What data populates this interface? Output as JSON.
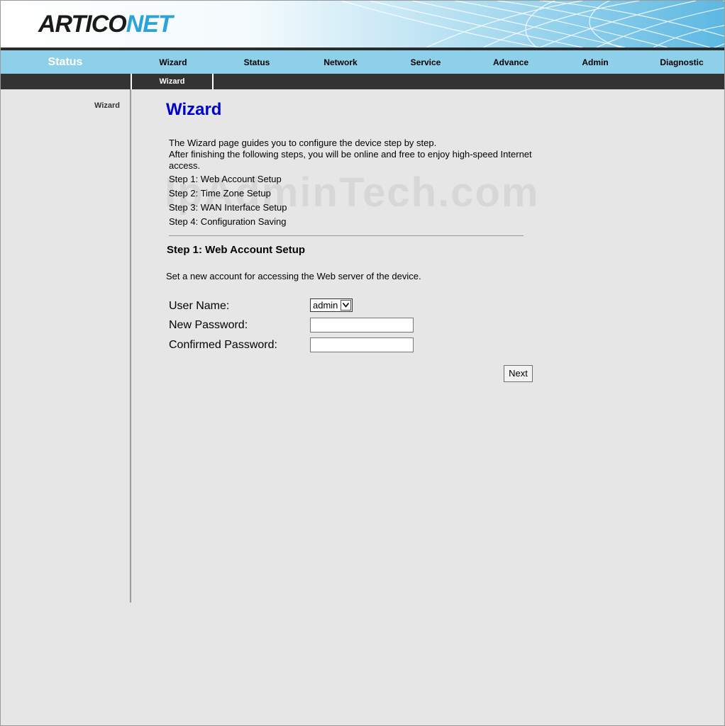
{
  "header": {
    "logo_part1": "ARTICO",
    "logo_part2": "NET"
  },
  "main_nav": {
    "current": "Status",
    "items": [
      "Wizard",
      "Status",
      "Network",
      "Service",
      "Advance",
      "Admin",
      "Diagnostic"
    ]
  },
  "sub_nav": {
    "items": [
      "Wizard"
    ]
  },
  "sidebar": {
    "items": [
      "Wizard"
    ]
  },
  "content": {
    "title": "Wizard",
    "intro_line1": "The Wizard page guides you to configure the device step by step.",
    "intro_line2": "After finishing the following steps, you will be online and free to enjoy high-speed Internet access.",
    "steps": [
      "Step 1: Web Account Setup",
      "Step 2: Time Zone Setup",
      "Step 3: WAN Interface Setup",
      "Step 4: Configuration Saving"
    ],
    "watermark": "IpAdminTech.com",
    "section_title": "Step 1: Web Account Setup",
    "section_desc": "Set a new account for accessing the Web server of the device.",
    "form": {
      "username_label": "User Name:",
      "username_value": "admin",
      "new_password_label": "New Password:",
      "confirm_password_label": "Confirmed Password:"
    },
    "next_button": "Next"
  }
}
